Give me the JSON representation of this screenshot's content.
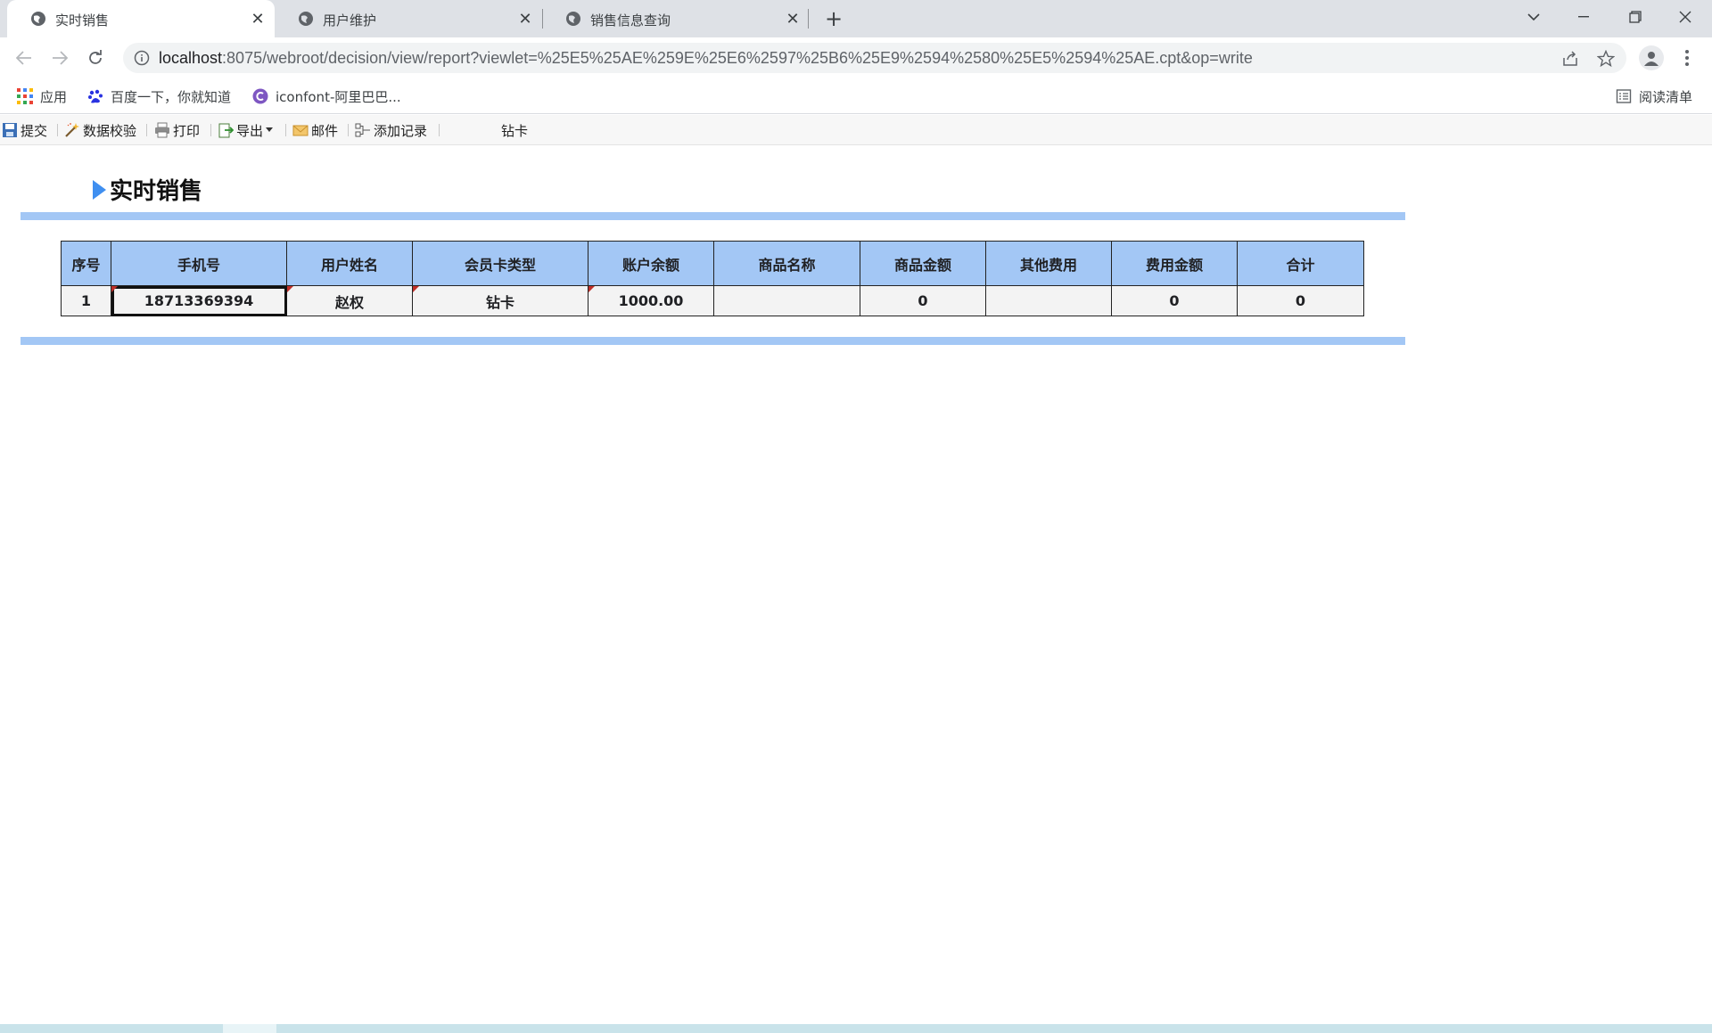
{
  "browser": {
    "tabs": [
      {
        "title": "实时销售",
        "active": true
      },
      {
        "title": "用户维护",
        "active": false
      },
      {
        "title": "销售信息查询",
        "active": false
      }
    ],
    "url_host": "localhost",
    "url_rest": ":8075/webroot/decision/view/report?viewlet=%25E5%25AE%259E%25E6%2597%25B6%25E9%2594%2580%25E5%2594%25AE.cpt&op=write",
    "bookmarks": {
      "apps": "应用",
      "baidu": "百度一下，你就知道",
      "iconfont": "iconfont-阿里巴巴..."
    },
    "reading_list": "阅读清单"
  },
  "report_toolbar": {
    "submit": "提交",
    "validate": "数据校验",
    "print": "打印",
    "export": "导出",
    "mail": "邮件",
    "add_record": "添加记录",
    "filter_value": "钻卡"
  },
  "report": {
    "title": "实时销售",
    "columns": [
      "序号",
      "手机号",
      "用户姓名",
      "会员卡类型",
      "账户余额",
      "商品名称",
      "商品金额",
      "其他费用",
      "费用金额",
      "合计"
    ],
    "rows": [
      [
        "1",
        "18713369394",
        "赵权",
        "钻卡",
        "1000.00",
        "",
        "0",
        "",
        "0",
        "0"
      ]
    ]
  },
  "colors": {
    "header_bg": "#a3c7f5",
    "accent": "#3f8ff0",
    "cell_bg": "#f3f3f3",
    "edit_marker": "#c0302a"
  }
}
